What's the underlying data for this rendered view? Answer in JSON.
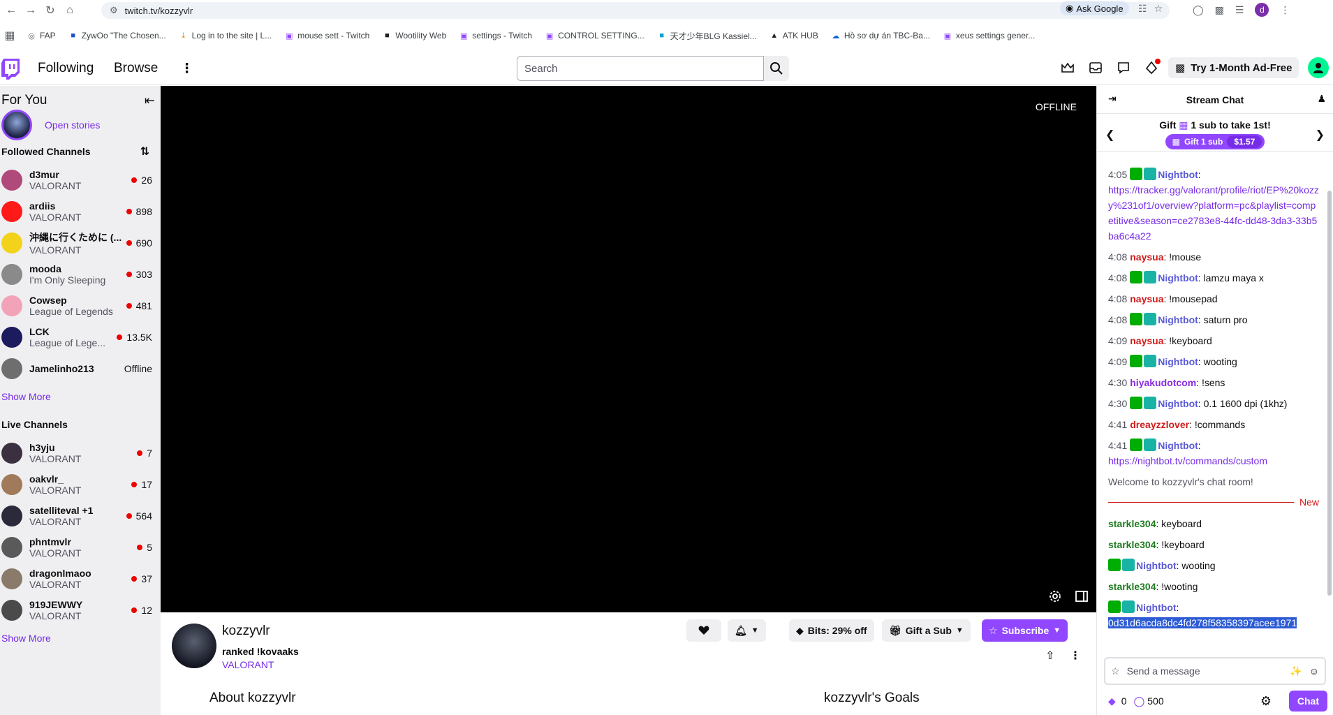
{
  "browser": {
    "url": "twitch.tv/kozzyvlr",
    "ask_google": "Ask Google",
    "profile_initial": "d",
    "bookmarks": [
      {
        "label": "FAP",
        "icon": "globe-icon",
        "color": "#5f6368"
      },
      {
        "label": "ZywOo \"The Chosen...",
        "icon": "bookmark-icon",
        "color": "#1e4fd1"
      },
      {
        "label": "Log in to the site | L...",
        "icon": "download-icon",
        "color": "#e07b00"
      },
      {
        "label": "mouse sett - Twitch",
        "icon": "twitch-icon",
        "color": "#9147ff"
      },
      {
        "label": "Wootility Web",
        "icon": "wooting-icon",
        "color": "#222222"
      },
      {
        "label": "settings - Twitch",
        "icon": "twitch-icon",
        "color": "#9147ff"
      },
      {
        "label": "CONTROL SETTING...",
        "icon": "twitch-icon",
        "color": "#9147ff"
      },
      {
        "label": "天才少年BLG Kassiel...",
        "icon": "bilibili-icon",
        "color": "#00a1d6"
      },
      {
        "label": "ATK HUB",
        "icon": "atk-icon",
        "color": "#222222"
      },
      {
        "label": "Hồ sơ dự án TBC-Ba...",
        "icon": "onedrive-icon",
        "color": "#0a66d8"
      },
      {
        "label": "xeus settings gener...",
        "icon": "twitch-icon",
        "color": "#9147ff"
      }
    ]
  },
  "nav": {
    "following": "Following",
    "browse": "Browse",
    "search_placeholder": "Search",
    "adfree": "Try 1-Month Ad-Free"
  },
  "sidebar": {
    "for_you": "For You",
    "open_stories": "Open stories",
    "followed_title": "Followed Channels",
    "followed": [
      {
        "name": "d3mur",
        "game": "VALORANT",
        "viewers": "26",
        "live": true,
        "color": "#b04a7a"
      },
      {
        "name": "ardiis",
        "game": "VALORANT",
        "viewers": "898",
        "live": true,
        "color": "#ff1a1a"
      },
      {
        "name": "沖縄に行くために (...",
        "game": "VALORANT",
        "viewers": "690",
        "live": true,
        "color": "#f2d21b"
      },
      {
        "name": "mooda",
        "game": "I'm Only Sleeping",
        "viewers": "303",
        "live": true,
        "color": "#8a8a8a"
      },
      {
        "name": "Cowsep",
        "game": "League of Legends",
        "viewers": "481",
        "live": true,
        "color": "#f2a3b8"
      },
      {
        "name": "LCK",
        "game": "League of Lege...",
        "viewers": "13.5K",
        "live": true,
        "color": "#1b1b5e"
      },
      {
        "name": "Jamelinho213",
        "game": "",
        "viewers": "Offline",
        "live": false,
        "color": "#6e6e6e"
      }
    ],
    "show_more_1": "Show More",
    "live_title": "Live Channels",
    "live": [
      {
        "name": "h3yju",
        "game": "VALORANT",
        "viewers": "7",
        "color": "#3a3040"
      },
      {
        "name": "oakvlr_",
        "game": "VALORANT",
        "viewers": "17",
        "color": "#a07a5a"
      },
      {
        "name": "satelliteval +1",
        "game": "VALORANT",
        "viewers": "564",
        "color": "#2a2a3a"
      },
      {
        "name": "phntmvlr",
        "game": "VALORANT",
        "viewers": "5",
        "color": "#5a5a5a"
      },
      {
        "name": "dragonlmaoo",
        "game": "VALORANT",
        "viewers": "37",
        "color": "#8a7a6a"
      },
      {
        "name": "919JEWWY",
        "game": "VALORANT",
        "viewers": "12",
        "color": "#4a4a4a"
      }
    ],
    "show_more_2": "Show More"
  },
  "player": {
    "status": "OFFLINE"
  },
  "channel": {
    "name": "kozzyvlr",
    "title": "ranked !kovaaks",
    "game": "VALORANT",
    "bits": "Bits: 29% off",
    "gift_sub": "Gift a Sub",
    "subscribe": "Subscribe",
    "about": "About kozzyvlr",
    "goals": "kozzyvlr's Goals"
  },
  "chat": {
    "title": "Stream Chat",
    "gift_text_a": "Gift",
    "gift_text_b": "1 sub to take 1st!",
    "gift_btn": "Gift 1 sub",
    "gift_price": "$1.57",
    "messages": [
      {
        "time": "4:05",
        "user": "Nightbot",
        "badges": true,
        "cls": "u-nb",
        "text": "https://tracker.gg/valorant/profile/riot/EP%20kozzy%231of1/overview?platform=pc&playlist=competitive&season=ce2783e8-44fc-dd48-3da3-33b5ba6c4a22",
        "link": true,
        "break": true
      },
      {
        "time": "4:08",
        "user": "naysua",
        "badges": false,
        "cls": "u-red",
        "text": "!mouse"
      },
      {
        "time": "4:08",
        "user": "Nightbot",
        "badges": true,
        "cls": "u-nb",
        "text": "lamzu maya x"
      },
      {
        "time": "4:08",
        "user": "naysua",
        "badges": false,
        "cls": "u-red",
        "text": "!mousepad"
      },
      {
        "time": "4:08",
        "user": "Nightbot",
        "badges": true,
        "cls": "u-nb",
        "text": "saturn pro"
      },
      {
        "time": "4:09",
        "user": "naysua",
        "badges": false,
        "cls": "u-red",
        "text": "!keyboard"
      },
      {
        "time": "4:09",
        "user": "Nightbot",
        "badges": true,
        "cls": "u-nb",
        "text": "wooting"
      },
      {
        "time": "4:30",
        "user": "hiyakudotcom",
        "badges": false,
        "cls": "u-hy",
        "text": "!sens"
      },
      {
        "time": "4:30",
        "user": "Nightbot",
        "badges": true,
        "cls": "u-nb",
        "text": "0.1 1600 dpi (1khz)"
      },
      {
        "time": "4:41",
        "user": "dreayzzlover",
        "badges": false,
        "cls": "u-red",
        "text": "!commands"
      },
      {
        "time": "4:41",
        "user": "Nightbot",
        "badges": true,
        "cls": "u-nb",
        "text": "https://nightbot.tv/commands/custom",
        "link": true,
        "break": true
      }
    ],
    "welcome": "Welcome to kozzyvlr's chat room!",
    "new_label": "New",
    "after": [
      {
        "time": "",
        "user": "starkle304",
        "badges": false,
        "cls": "u-green",
        "text": "keyboard"
      },
      {
        "time": "",
        "user": "starkle304",
        "badges": false,
        "cls": "u-green",
        "text": "!keyboard"
      },
      {
        "time": "",
        "user": "Nightbot",
        "badges": true,
        "cls": "u-nb",
        "text": "wooting"
      },
      {
        "time": "",
        "user": "starkle304",
        "badges": false,
        "cls": "u-green",
        "text": "!wooting"
      },
      {
        "time": "",
        "user": "Nightbot",
        "badges": true,
        "cls": "u-nb",
        "text": "0d31d6acda8dc4fd278f58358397acee1971",
        "selected": true,
        "break": true
      }
    ],
    "input_placeholder": "Send a message",
    "bits_count": "0",
    "points": "500",
    "chat_btn": "Chat"
  }
}
